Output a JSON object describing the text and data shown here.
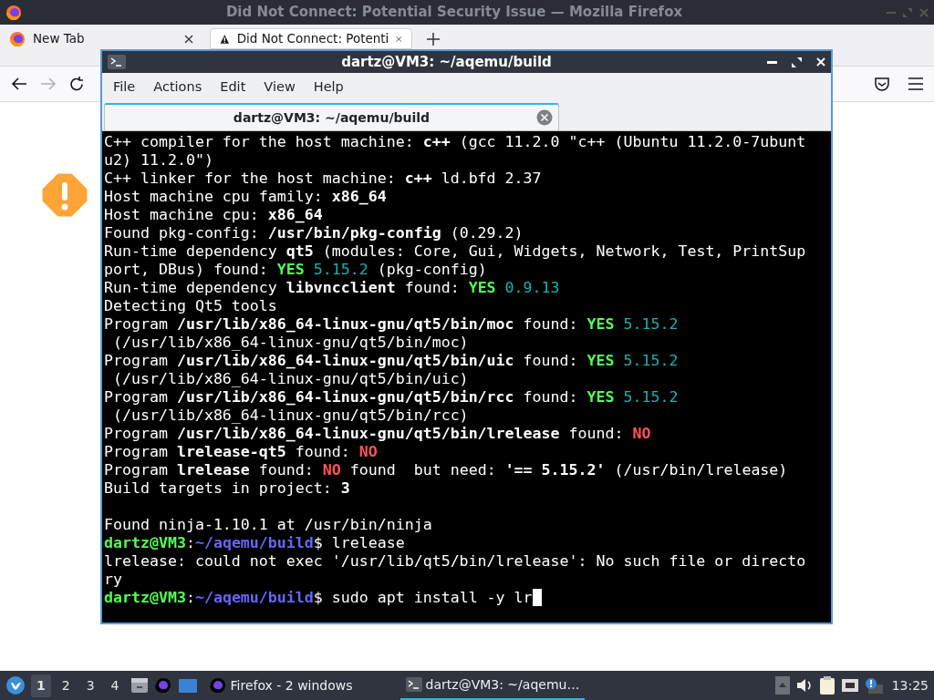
{
  "browser": {
    "title": "Did Not Connect: Potential Security Issue — Mozilla Firefox",
    "tabs": [
      {
        "label": "New Tab",
        "selected": false
      },
      {
        "label": "Did Not Connect: Potenti",
        "selected": true
      }
    ],
    "forward_disabled": true
  },
  "terminal": {
    "title": "dartz@VM3: ~/aqemu/build",
    "menu": [
      "File",
      "Actions",
      "Edit",
      "View",
      "Help"
    ],
    "tabs": [
      {
        "label": "dartz@VM3: ~/aqemu/build",
        "selected": true
      }
    ],
    "lines": [
      {
        "segments": [
          {
            "kind": "plain",
            "text": "C++ compiler for the host machine: "
          },
          {
            "kind": "bold",
            "text": "c++"
          },
          {
            "kind": "plain",
            "text": " (gcc 11.2.0 \"c++ (Ubuntu 11.2.0-7ubunt"
          }
        ]
      },
      {
        "segments": [
          {
            "kind": "plain",
            "text": "u2) 11.2.0\")"
          }
        ]
      },
      {
        "segments": [
          {
            "kind": "plain",
            "text": "C++ linker for the host machine: "
          },
          {
            "kind": "bold",
            "text": "c++"
          },
          {
            "kind": "plain",
            "text": " ld.bfd 2.37"
          }
        ]
      },
      {
        "segments": [
          {
            "kind": "plain",
            "text": "Host machine cpu family: "
          },
          {
            "kind": "bold",
            "text": "x86_64"
          }
        ]
      },
      {
        "segments": [
          {
            "kind": "plain",
            "text": "Host machine cpu: "
          },
          {
            "kind": "bold",
            "text": "x86_64"
          }
        ]
      },
      {
        "segments": [
          {
            "kind": "plain",
            "text": "Found pkg-config: "
          },
          {
            "kind": "bold",
            "text": "/usr/bin/pkg-config"
          },
          {
            "kind": "plain",
            "text": " (0.29.2)"
          }
        ]
      },
      {
        "segments": [
          {
            "kind": "plain",
            "text": "Run-time dependency "
          },
          {
            "kind": "bold",
            "text": "qt5"
          },
          {
            "kind": "plain",
            "text": " (modules: Core, Gui, Widgets, Network, Test, PrintSup"
          }
        ]
      },
      {
        "segments": [
          {
            "kind": "plain",
            "text": "port, DBus) found: "
          },
          {
            "kind": "yes",
            "text": "YES"
          },
          {
            "kind": "version",
            "text": " 5.15.2"
          },
          {
            "kind": "plain",
            "text": " (pkg-config)"
          }
        ]
      },
      {
        "segments": [
          {
            "kind": "plain",
            "text": "Run-time dependency "
          },
          {
            "kind": "bold",
            "text": "libvncclient"
          },
          {
            "kind": "plain",
            "text": " found: "
          },
          {
            "kind": "yes",
            "text": "YES"
          },
          {
            "kind": "version",
            "text": " 0.9.13"
          }
        ]
      },
      {
        "segments": [
          {
            "kind": "plain",
            "text": "Detecting Qt5 tools"
          }
        ]
      },
      {
        "segments": [
          {
            "kind": "plain",
            "text": "Program "
          },
          {
            "kind": "bold",
            "text": "/usr/lib/x86_64-linux-gnu/qt5/bin/moc"
          },
          {
            "kind": "plain",
            "text": " found: "
          },
          {
            "kind": "yes",
            "text": "YES"
          },
          {
            "kind": "version",
            "text": " 5.15.2"
          }
        ]
      },
      {
        "segments": [
          {
            "kind": "plain",
            "text": " (/usr/lib/x86_64-linux-gnu/qt5/bin/moc)"
          }
        ]
      },
      {
        "segments": [
          {
            "kind": "plain",
            "text": "Program "
          },
          {
            "kind": "bold",
            "text": "/usr/lib/x86_64-linux-gnu/qt5/bin/uic"
          },
          {
            "kind": "plain",
            "text": " found: "
          },
          {
            "kind": "yes",
            "text": "YES"
          },
          {
            "kind": "version",
            "text": " 5.15.2"
          }
        ]
      },
      {
        "segments": [
          {
            "kind": "plain",
            "text": " (/usr/lib/x86_64-linux-gnu/qt5/bin/uic)"
          }
        ]
      },
      {
        "segments": [
          {
            "kind": "plain",
            "text": "Program "
          },
          {
            "kind": "bold",
            "text": "/usr/lib/x86_64-linux-gnu/qt5/bin/rcc"
          },
          {
            "kind": "plain",
            "text": " found: "
          },
          {
            "kind": "yes",
            "text": "YES"
          },
          {
            "kind": "version",
            "text": " 5.15.2"
          }
        ]
      },
      {
        "segments": [
          {
            "kind": "plain",
            "text": " (/usr/lib/x86_64-linux-gnu/qt5/bin/rcc)"
          }
        ]
      },
      {
        "segments": [
          {
            "kind": "plain",
            "text": "Program "
          },
          {
            "kind": "bold",
            "text": "/usr/lib/x86_64-linux-gnu/qt5/bin/lrelease"
          },
          {
            "kind": "plain",
            "text": " found: "
          },
          {
            "kind": "no",
            "text": "NO"
          }
        ]
      },
      {
        "segments": [
          {
            "kind": "plain",
            "text": "Program "
          },
          {
            "kind": "bold",
            "text": "lrelease-qt5"
          },
          {
            "kind": "plain",
            "text": " found: "
          },
          {
            "kind": "no",
            "text": "NO"
          }
        ]
      },
      {
        "segments": [
          {
            "kind": "plain",
            "text": "Program "
          },
          {
            "kind": "bold",
            "text": "lrelease"
          },
          {
            "kind": "plain",
            "text": " found: "
          },
          {
            "kind": "no",
            "text": "NO"
          },
          {
            "kind": "plain",
            "text": " found  but need: "
          },
          {
            "kind": "bold",
            "text": "'== 5.15.2'"
          },
          {
            "kind": "plain",
            "text": " (/usr/bin/lrelease)"
          }
        ]
      },
      {
        "segments": [
          {
            "kind": "plain",
            "text": "Build targets in project: "
          },
          {
            "kind": "bold",
            "text": "3"
          }
        ]
      },
      {
        "gap_before": true,
        "segments": [
          {
            "kind": "plain",
            "text": "Found ninja-1.10.1 at /usr/bin/ninja"
          }
        ]
      },
      {
        "segments": [
          {
            "kind": "user",
            "text": "dartz@VM3"
          },
          {
            "kind": "plain",
            "text": ":"
          },
          {
            "kind": "path",
            "text": "~/aqemu/build"
          },
          {
            "kind": "plain",
            "text": "$ lrelease"
          }
        ]
      },
      {
        "segments": [
          {
            "kind": "plain",
            "text": "lrelease: could not exec '/usr/lib/qt5/bin/lrelease': No such file or directo"
          }
        ]
      },
      {
        "segments": [
          {
            "kind": "plain",
            "text": "ry"
          }
        ]
      },
      {
        "cursor": true,
        "segments": [
          {
            "kind": "user",
            "text": "dartz@VM3"
          },
          {
            "kind": "plain",
            "text": ":"
          },
          {
            "kind": "path",
            "text": "~/aqemu/build"
          },
          {
            "kind": "plain",
            "text": "$ sudo apt install -y lr"
          }
        ]
      }
    ]
  },
  "taskbar": {
    "workspaces": [
      {
        "label": "1",
        "selected": true
      },
      {
        "label": "2",
        "selected": false
      },
      {
        "label": "3",
        "selected": false
      },
      {
        "label": "4",
        "selected": false
      }
    ],
    "tasks": [
      {
        "kind": "firefox",
        "label": "Firefox - 2 windows",
        "selected": false
      },
      {
        "kind": "terminal",
        "label": "dartz@VM3: ~/aqemu…",
        "selected": true
      }
    ],
    "clock": "13:25"
  }
}
